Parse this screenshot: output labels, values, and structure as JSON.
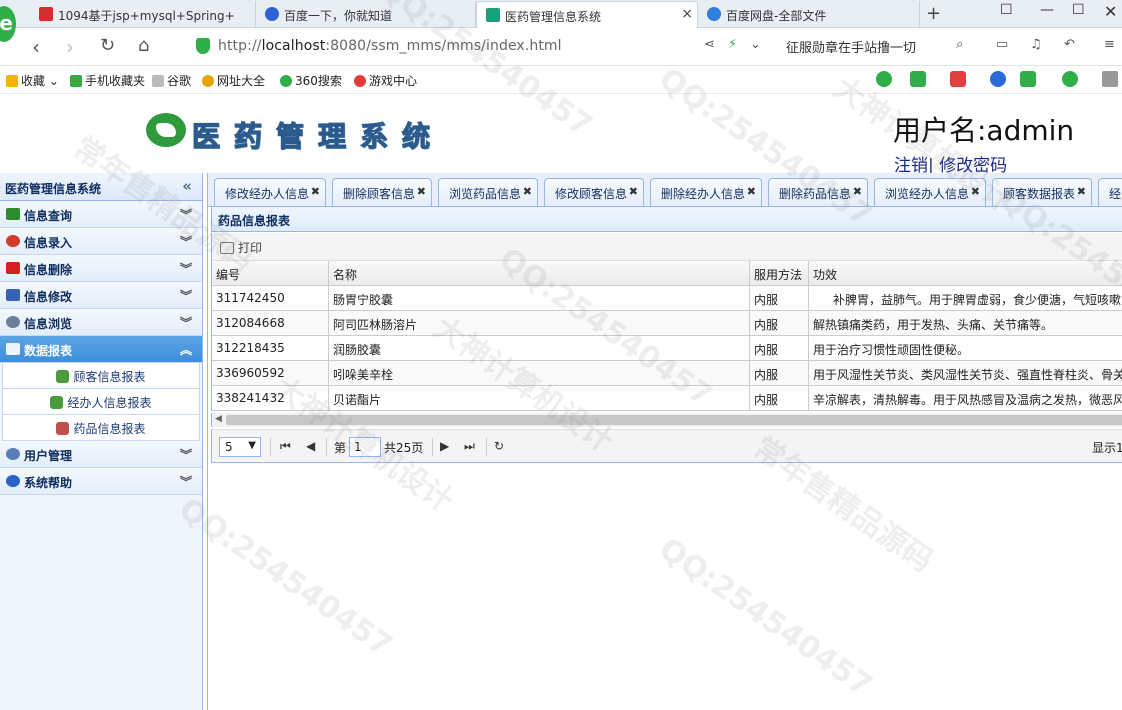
{
  "browser": {
    "tabs": [
      {
        "label": "1094基于jsp+mysql+Spring+",
        "color": "#d32f2f"
      },
      {
        "label": "百度一下，你就知道",
        "color": "#2e63d6"
      },
      {
        "label": "医药管理信息系统",
        "color": "#1b9e7a"
      },
      {
        "label": "百度网盘-全部文件",
        "color": "#2f7fe0"
      }
    ],
    "close_glyph": "×",
    "new_tab_glyph": "+",
    "url_prefix": "http://",
    "url_host": "localhost",
    "url_rest": ":8080/ssm_mms/mms/index.html",
    "news_text": "征服勋章在手站撸一切",
    "bookmarks": [
      {
        "label": "收藏",
        "color": "#f2b600"
      },
      {
        "label": "手机收藏夹",
        "color": "#39a845"
      },
      {
        "label": "谷歌",
        "color": "#bbbbbb"
      },
      {
        "label": "网址大全",
        "color": "#e8a300"
      },
      {
        "label": "360搜索",
        "color": "#2fae49"
      },
      {
        "label": "游戏中心",
        "color": "#e23b3b"
      }
    ]
  },
  "app": {
    "logo_text": "医药管理系统",
    "user_title": "用户名:admin",
    "logout_label": "注销",
    "change_password_label": "修改密码"
  },
  "sidebar": {
    "title": "医药管理信息系统",
    "collapse_glyph": "«",
    "sections": [
      {
        "label": "信息查询",
        "color": "#2d8b2d"
      },
      {
        "label": "信息录入",
        "color": "#d33b2b"
      },
      {
        "label": "信息删除",
        "color": "#d32020"
      },
      {
        "label": "信息修改",
        "color": "#3662b8"
      },
      {
        "label": "信息浏览",
        "color": "#6a7f99"
      },
      {
        "label": "数据报表",
        "color": "#eef4fb"
      }
    ],
    "report_items": [
      {
        "label": "顾客信息报表",
        "color": "#4b9a3b"
      },
      {
        "label": "经办人信息报表",
        "color": "#4b9a3b"
      },
      {
        "label": "药品信息报表",
        "color": "#c0504d"
      }
    ],
    "bottom_sections": [
      {
        "label": "用户管理",
        "color": "#5a7fb8"
      },
      {
        "label": "系统帮助",
        "color": "#2a62c6"
      }
    ]
  },
  "main": {
    "tabs": [
      "修改经办人信息",
      "删除顾客信息",
      "浏览药品信息",
      "修改顾客信息",
      "删除经办人信息",
      "删除药品信息",
      "浏览经办人信息",
      "顾客数据报表",
      "经"
    ],
    "panel_title": "药品信息报表",
    "print_label": "打印",
    "columns": [
      "编号",
      "名称",
      "服用方法",
      "功效"
    ],
    "rows": [
      [
        "311742450",
        "肠胃宁胶囊",
        "内服",
        "补脾胃，益肺气。用于脾胃虚弱，食少便溏，气短咳嗽"
      ],
      [
        "312084668",
        "阿司匹林肠溶片",
        "内服",
        "解热镇痛类药，用于发热、头痛、关节痛等。"
      ],
      [
        "312218435",
        "润肠胶囊",
        "内服",
        "用于治疗习惯性顽固性便秘。"
      ],
      [
        "336960592",
        "吲哚美辛栓",
        "内服",
        "用于风湿性关节炎、类风湿性关节炎、强直性脊柱炎、骨关"
      ],
      [
        "338241432",
        "贝诺酯片",
        "内服",
        "辛凉解表，清热解毒。用于风热感冒及温病之发热，微恶风"
      ]
    ],
    "pager": {
      "page_size": "5",
      "page_prefix": "第",
      "current_page": "1",
      "total_pages_text": "共25页",
      "display_text": "显示1"
    }
  },
  "watermarks": [
    "QQ:254540457",
    "大神计算机设计",
    "常年售精品源码"
  ]
}
